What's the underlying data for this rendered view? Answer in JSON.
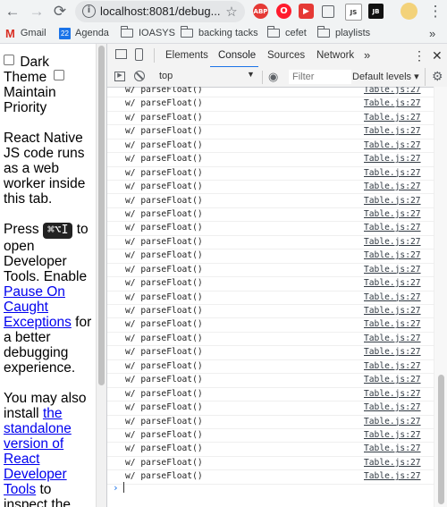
{
  "browser": {
    "url": "localhost:8081/debug...",
    "star": "☆",
    "ext_abp": "ABP",
    "ext_js": "JS",
    "ext_jb": "JB",
    "menu": "⋮"
  },
  "bookmarks": {
    "gmail": "Gmail",
    "agenda_day": "22",
    "agenda": "Agenda",
    "ioasys": "IOASYS",
    "backing": "backing tacks",
    "cefet": "cefet",
    "playlists": "playlists",
    "more": "»"
  },
  "page": {
    "dark_theme": "Dark Theme",
    "maintain_priority": "Maintain Priority",
    "intro": "React Native JS code runs as a web worker inside this tab.",
    "press": "Press",
    "shortcut": "⌘⌥I",
    "to_open": "to open Developer Tools. Enable",
    "pause_link": "Pause On Caught Exceptions",
    "for_better": "for a better debugging experience.",
    "you_may": "You may also install",
    "standalone_link": "the standalone version of React Developer Tools",
    "to_inspect": "to inspect the"
  },
  "devtools": {
    "tabs": [
      "Elements",
      "Console",
      "Sources",
      "Network"
    ],
    "more_tabs": "»",
    "context": "top",
    "filter_placeholder": "Filter",
    "levels": "Default levels ▾",
    "log_message": "w/ parseFloat()",
    "log_source": "Table.js:27",
    "log_count": 29,
    "prompt_symbol": "›"
  },
  "colors": {
    "accent": "#1a73e8",
    "abp": "#e53935",
    "opera": "#ff1b2d",
    "yt": "#e53935"
  }
}
